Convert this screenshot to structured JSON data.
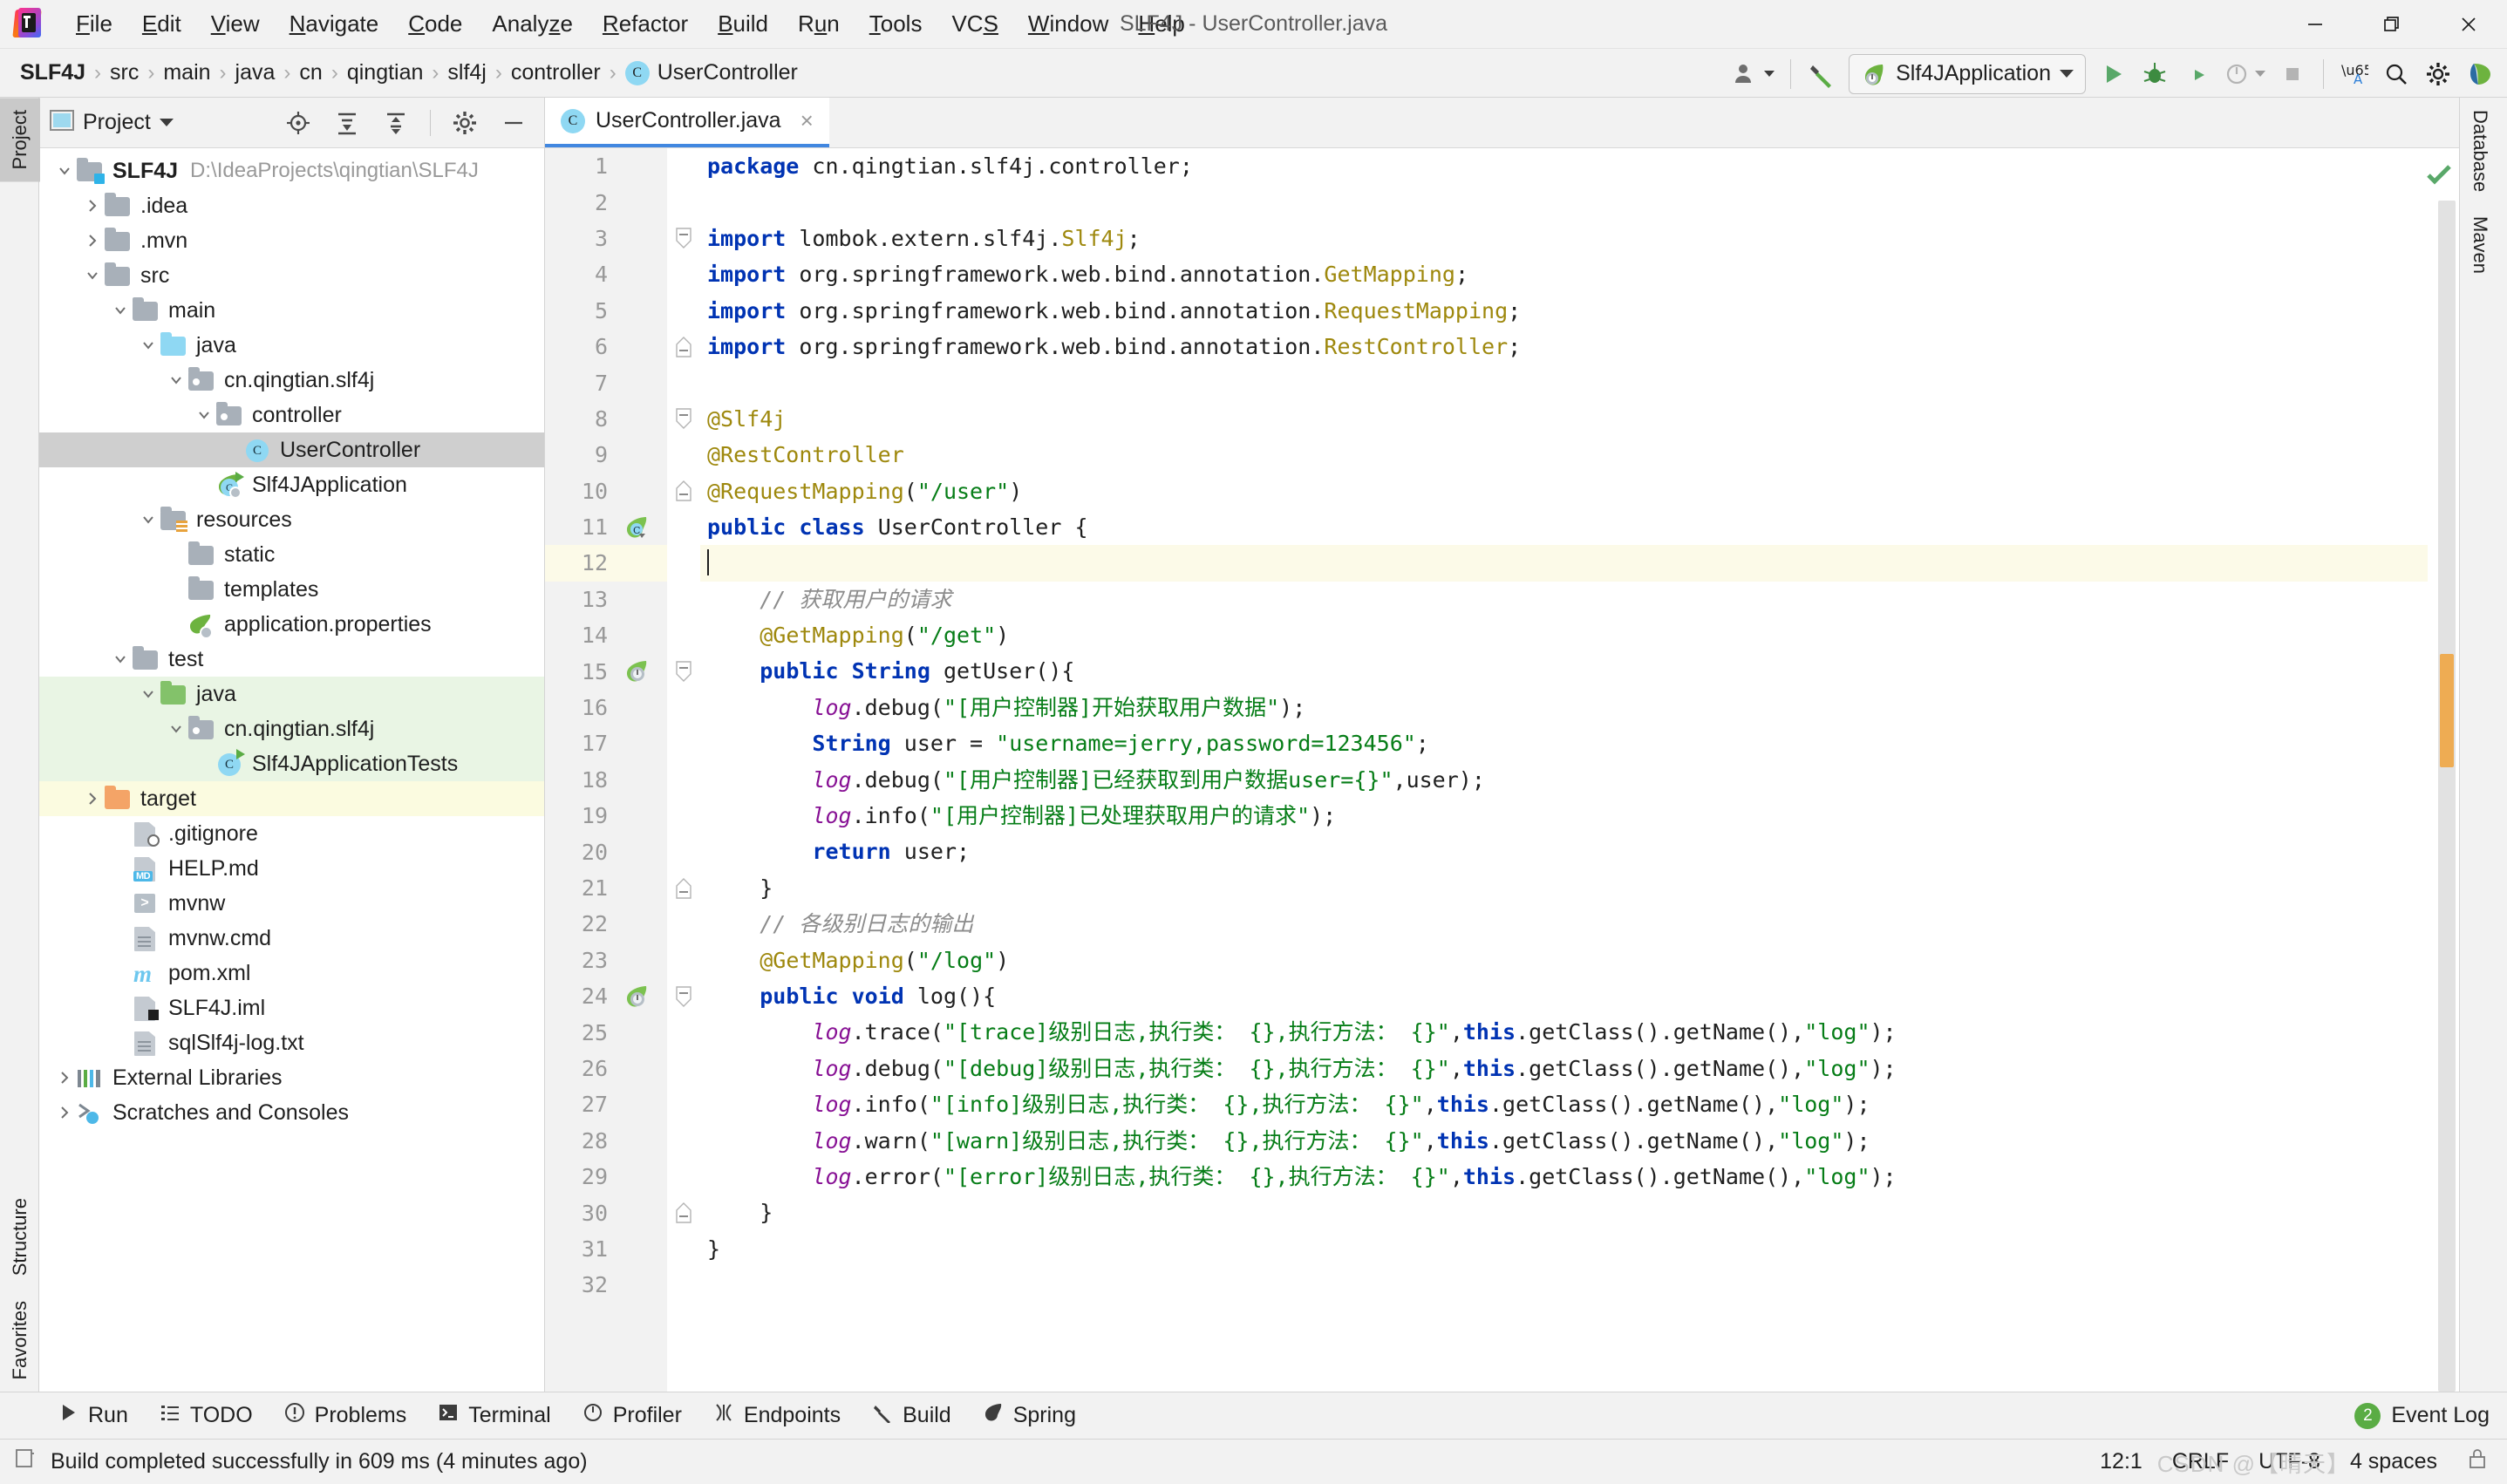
{
  "window": {
    "title": "SLF4J - UserController.java",
    "controls": {
      "minimize": "minimize-icon",
      "maximize": "restore-icon",
      "close": "close-icon"
    }
  },
  "menubar": {
    "items": [
      {
        "label": "File",
        "mnemonic": "F"
      },
      {
        "label": "Edit",
        "mnemonic": "E"
      },
      {
        "label": "View",
        "mnemonic": "V"
      },
      {
        "label": "Navigate",
        "mnemonic": "N"
      },
      {
        "label": "Code",
        "mnemonic": "C"
      },
      {
        "label": "Analyze",
        "mnemonic": "z"
      },
      {
        "label": "Refactor",
        "mnemonic": "R"
      },
      {
        "label": "Build",
        "mnemonic": "B"
      },
      {
        "label": "Run",
        "mnemonic": "u"
      },
      {
        "label": "Tools",
        "mnemonic": "T"
      },
      {
        "label": "VCS",
        "mnemonic": "S"
      },
      {
        "label": "Window",
        "mnemonic": "W"
      },
      {
        "label": "Help",
        "mnemonic": "H"
      }
    ]
  },
  "breadcrumb": {
    "items": [
      "SLF4J",
      "src",
      "main",
      "java",
      "cn",
      "qingtian",
      "slf4j",
      "controller"
    ],
    "file": "UserController",
    "file_badge": "C",
    "separator": "›"
  },
  "toolbar": {
    "run_config": "Slf4JApplication",
    "buttons": [
      {
        "name": "user-account-button",
        "label": ""
      },
      {
        "name": "build-hammer-button",
        "label": ""
      },
      {
        "name": "run-button",
        "label": ""
      },
      {
        "name": "debug-button",
        "label": ""
      },
      {
        "name": "run-with-coverage-button",
        "label": ""
      },
      {
        "name": "profiler-button",
        "label": ""
      },
      {
        "name": "stop-button",
        "label": ""
      },
      {
        "name": "translate-button",
        "label": ""
      },
      {
        "name": "search-everywhere-button",
        "label": ""
      },
      {
        "name": "settings-gear-button",
        "label": ""
      },
      {
        "name": "spring-boot-dashboard-button",
        "label": ""
      }
    ]
  },
  "left_rail": {
    "top": [
      {
        "label": "Project",
        "active": true
      }
    ],
    "bottom": [
      {
        "label": "Structure",
        "active": false
      },
      {
        "label": "Favorites",
        "active": false
      }
    ]
  },
  "right_rail": {
    "items": [
      {
        "label": "Database"
      },
      {
        "label": "Maven"
      }
    ]
  },
  "project_panel": {
    "title": "Project",
    "header_buttons": [
      "locate-icon",
      "expand-all-icon",
      "collapse-all-icon",
      "settings-gear-icon",
      "hide-icon"
    ],
    "tree": [
      {
        "label": "SLF4J",
        "path": "D:\\IdeaProjects\\qingtian\\SLF4J",
        "depth": 0,
        "arrow": "down",
        "icon": "module-folder",
        "bold": true,
        "state": "none"
      },
      {
        "label": ".idea",
        "path": "",
        "depth": 1,
        "arrow": "right",
        "icon": "folder",
        "bold": false,
        "state": "none"
      },
      {
        "label": ".mvn",
        "path": "",
        "depth": 1,
        "arrow": "right",
        "icon": "folder",
        "bold": false,
        "state": "none"
      },
      {
        "label": "src",
        "path": "",
        "depth": 1,
        "arrow": "down",
        "icon": "folder",
        "bold": false,
        "state": "none"
      },
      {
        "label": "main",
        "path": "",
        "depth": 2,
        "arrow": "down",
        "icon": "folder",
        "bold": false,
        "state": "none"
      },
      {
        "label": "java",
        "path": "",
        "depth": 3,
        "arrow": "down",
        "icon": "folder-blue",
        "bold": false,
        "state": "none"
      },
      {
        "label": "cn.qingtian.slf4j",
        "path": "",
        "depth": 4,
        "arrow": "down",
        "icon": "package",
        "bold": false,
        "state": "none"
      },
      {
        "label": "controller",
        "path": "",
        "depth": 5,
        "arrow": "down",
        "icon": "package",
        "bold": false,
        "state": "none"
      },
      {
        "label": "UserController",
        "path": "",
        "depth": 6,
        "arrow": "none",
        "icon": "java-class",
        "bold": false,
        "state": "selected"
      },
      {
        "label": "Slf4JApplication",
        "path": "",
        "depth": 5,
        "arrow": "none",
        "icon": "spring-class-run",
        "bold": false,
        "state": "none"
      },
      {
        "label": "resources",
        "path": "",
        "depth": 3,
        "arrow": "down",
        "icon": "folder-resources",
        "bold": false,
        "state": "none"
      },
      {
        "label": "static",
        "path": "",
        "depth": 4,
        "arrow": "none",
        "icon": "folder",
        "bold": false,
        "state": "none"
      },
      {
        "label": "templates",
        "path": "",
        "depth": 4,
        "arrow": "none",
        "icon": "folder",
        "bold": false,
        "state": "none"
      },
      {
        "label": "application.properties",
        "path": "",
        "depth": 4,
        "arrow": "none",
        "icon": "spring-properties",
        "bold": false,
        "state": "none"
      },
      {
        "label": "test",
        "path": "",
        "depth": 2,
        "arrow": "down",
        "icon": "folder",
        "bold": false,
        "state": "none"
      },
      {
        "label": "java",
        "path": "",
        "depth": 3,
        "arrow": "down",
        "icon": "folder-green",
        "bold": false,
        "state": "green"
      },
      {
        "label": "cn.qingtian.slf4j",
        "path": "",
        "depth": 4,
        "arrow": "down",
        "icon": "package",
        "bold": false,
        "state": "green"
      },
      {
        "label": "Slf4JApplicationTests",
        "path": "",
        "depth": 5,
        "arrow": "none",
        "icon": "java-class-run",
        "bold": false,
        "state": "green"
      },
      {
        "label": "target",
        "path": "",
        "depth": 1,
        "arrow": "right",
        "icon": "folder-orange",
        "bold": false,
        "state": "yellow"
      },
      {
        "label": ".gitignore",
        "path": "",
        "depth": 2,
        "arrow": "none",
        "icon": "file-ignored",
        "bold": false,
        "state": "none"
      },
      {
        "label": "HELP.md",
        "path": "",
        "depth": 2,
        "arrow": "none",
        "icon": "file-md",
        "bold": false,
        "state": "none"
      },
      {
        "label": "mvnw",
        "path": "",
        "depth": 2,
        "arrow": "none",
        "icon": "file-script",
        "bold": false,
        "state": "none"
      },
      {
        "label": "mvnw.cmd",
        "path": "",
        "depth": 2,
        "arrow": "none",
        "icon": "file-text",
        "bold": false,
        "state": "none"
      },
      {
        "label": "pom.xml",
        "path": "",
        "depth": 2,
        "arrow": "none",
        "icon": "maven-pom",
        "bold": false,
        "state": "none"
      },
      {
        "label": "SLF4J.iml",
        "path": "",
        "depth": 2,
        "arrow": "none",
        "icon": "file-iml",
        "bold": false,
        "state": "none"
      },
      {
        "label": "sqlSlf4j-log.txt",
        "path": "",
        "depth": 2,
        "arrow": "none",
        "icon": "file-text",
        "bold": false,
        "state": "none"
      },
      {
        "label": "External Libraries",
        "path": "",
        "depth": 0,
        "arrow": "right",
        "icon": "libraries",
        "bold": false,
        "state": "none"
      },
      {
        "label": "Scratches and Consoles",
        "path": "",
        "depth": 0,
        "arrow": "right",
        "icon": "scratches",
        "bold": false,
        "state": "none"
      }
    ]
  },
  "editor": {
    "tab": {
      "label": "UserController.java",
      "badge": "C",
      "close": "×"
    },
    "current_line": 12,
    "inspection_status": "ok",
    "lines": [
      {
        "n": 1,
        "gutter": "",
        "fold": "",
        "text": "package cn.qingtian.slf4j.controller;"
      },
      {
        "n": 2,
        "gutter": "",
        "fold": "",
        "text": ""
      },
      {
        "n": 3,
        "gutter": "",
        "fold": "fold-open",
        "text": "import lombok.extern.slf4j.Slf4j;"
      },
      {
        "n": 4,
        "gutter": "",
        "fold": "",
        "text": "import org.springframework.web.bind.annotation.GetMapping;"
      },
      {
        "n": 5,
        "gutter": "",
        "fold": "",
        "text": "import org.springframework.web.bind.annotation.RequestMapping;"
      },
      {
        "n": 6,
        "gutter": "",
        "fold": "fold-end",
        "text": "import org.springframework.web.bind.annotation.RestController;"
      },
      {
        "n": 7,
        "gutter": "",
        "fold": "",
        "text": ""
      },
      {
        "n": 8,
        "gutter": "",
        "fold": "fold-open",
        "text": "@Slf4j"
      },
      {
        "n": 9,
        "gutter": "",
        "fold": "",
        "text": "@RestController"
      },
      {
        "n": 10,
        "gutter": "",
        "fold": "fold-end",
        "text": "@RequestMapping(\"/user\")"
      },
      {
        "n": 11,
        "gutter": "spring-bean",
        "fold": "",
        "text": "public class UserController {"
      },
      {
        "n": 12,
        "gutter": "",
        "fold": "",
        "text": ""
      },
      {
        "n": 13,
        "gutter": "",
        "fold": "",
        "text": "    // 获取用户的请求"
      },
      {
        "n": 14,
        "gutter": "",
        "fold": "",
        "text": "    @GetMapping(\"/get\")"
      },
      {
        "n": 15,
        "gutter": "spring-endpoint",
        "fold": "fold-open",
        "text": "    public String getUser(){"
      },
      {
        "n": 16,
        "gutter": "",
        "fold": "",
        "text": "        log.debug(\"[用户控制器]开始获取用户数据\");"
      },
      {
        "n": 17,
        "gutter": "",
        "fold": "",
        "text": "        String user = \"username=jerry,password=123456\";"
      },
      {
        "n": 18,
        "gutter": "",
        "fold": "",
        "text": "        log.debug(\"[用户控制器]已经获取到用户数据user={}\",user);"
      },
      {
        "n": 19,
        "gutter": "",
        "fold": "",
        "text": "        log.info(\"[用户控制器]已处理获取用户的请求\");"
      },
      {
        "n": 20,
        "gutter": "",
        "fold": "",
        "text": "        return user;"
      },
      {
        "n": 21,
        "gutter": "",
        "fold": "fold-end",
        "text": "    }"
      },
      {
        "n": 22,
        "gutter": "",
        "fold": "",
        "text": "    // 各级别日志的输出"
      },
      {
        "n": 23,
        "gutter": "",
        "fold": "",
        "text": "    @GetMapping(\"/log\")"
      },
      {
        "n": 24,
        "gutter": "spring-endpoint",
        "fold": "fold-open",
        "text": "    public void log(){"
      },
      {
        "n": 25,
        "gutter": "",
        "fold": "",
        "text": "        log.trace(\"[trace]级别日志,执行类： {},执行方法： {}\",this.getClass().getName(),\"log\");"
      },
      {
        "n": 26,
        "gutter": "",
        "fold": "",
        "text": "        log.debug(\"[debug]级别日志,执行类： {},执行方法： {}\",this.getClass().getName(),\"log\");"
      },
      {
        "n": 27,
        "gutter": "",
        "fold": "",
        "text": "        log.info(\"[info]级别日志,执行类： {},执行方法： {}\",this.getClass().getName(),\"log\");"
      },
      {
        "n": 28,
        "gutter": "",
        "fold": "",
        "text": "        log.warn(\"[warn]级别日志,执行类： {},执行方法： {}\",this.getClass().getName(),\"log\");"
      },
      {
        "n": 29,
        "gutter": "",
        "fold": "",
        "text": "        log.error(\"[error]级别日志,执行类： {},执行方法： {}\",this.getClass().getName(),\"log\");"
      },
      {
        "n": 30,
        "gutter": "",
        "fold": "fold-end",
        "text": "    }"
      },
      {
        "n": 31,
        "gutter": "",
        "fold": "",
        "text": "}"
      },
      {
        "n": 32,
        "gutter": "",
        "fold": "",
        "text": ""
      }
    ]
  },
  "tool_window_bar": {
    "items": [
      {
        "label": "Run",
        "icon": "play-icon"
      },
      {
        "label": "TODO",
        "icon": "todo-list-icon"
      },
      {
        "label": "Problems",
        "icon": "problems-icon"
      },
      {
        "label": "Terminal",
        "icon": "terminal-icon"
      },
      {
        "label": "Profiler",
        "icon": "profiler-icon"
      },
      {
        "label": "Endpoints",
        "icon": "endpoints-icon"
      },
      {
        "label": "Build",
        "icon": "build-hammer-icon"
      },
      {
        "label": "Spring",
        "icon": "spring-leaf-icon"
      }
    ],
    "event_log": {
      "label": "Event Log",
      "count": "2"
    }
  },
  "statusbar": {
    "message": "Build completed successfully in 609 ms (4 minutes ago)",
    "caret_position": "12:1",
    "line_separator": "CRLF",
    "encoding": "UTF-8",
    "indent": "4 spaces",
    "watermark": "CSDN @【晴天】"
  },
  "colors": {
    "accent": "#4187e0",
    "keyword": "#0033b3",
    "annotation": "#9e880d",
    "string": "#067d17",
    "comment": "#8c8c8c",
    "field": "#871094",
    "green": "#5aac44",
    "panel": "#f2f2f2",
    "selection": "#cfcfcf",
    "current_line": "#fcfae8"
  }
}
